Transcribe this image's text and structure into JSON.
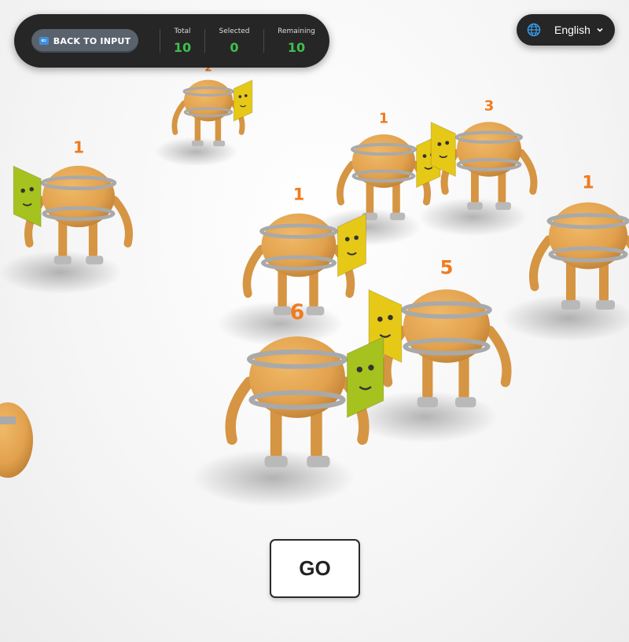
{
  "header": {
    "back_button_label": "BACK TO INPUT",
    "stats": [
      {
        "label": "Total",
        "value": "10"
      },
      {
        "label": "Selected",
        "value": "0"
      },
      {
        "label": "Remaining",
        "value": "10"
      }
    ]
  },
  "language": {
    "selected": "English"
  },
  "go_button": {
    "label": "GO"
  },
  "robots": [
    {
      "number": "2"
    },
    {
      "number": "1"
    },
    {
      "number": "1"
    },
    {
      "number": "3"
    },
    {
      "number": "1"
    },
    {
      "number": "1"
    },
    {
      "number": "5"
    },
    {
      "number": "6"
    }
  ],
  "colors": {
    "hud_background": "#262626",
    "stat_value": "#3fbf4f",
    "robot_body": "#e3a552",
    "robot_band": "#a9a9a9",
    "face_screen_yellow": "#e6c817",
    "face_screen_green": "#a6c21e",
    "number_orange": "#f07b1e"
  }
}
